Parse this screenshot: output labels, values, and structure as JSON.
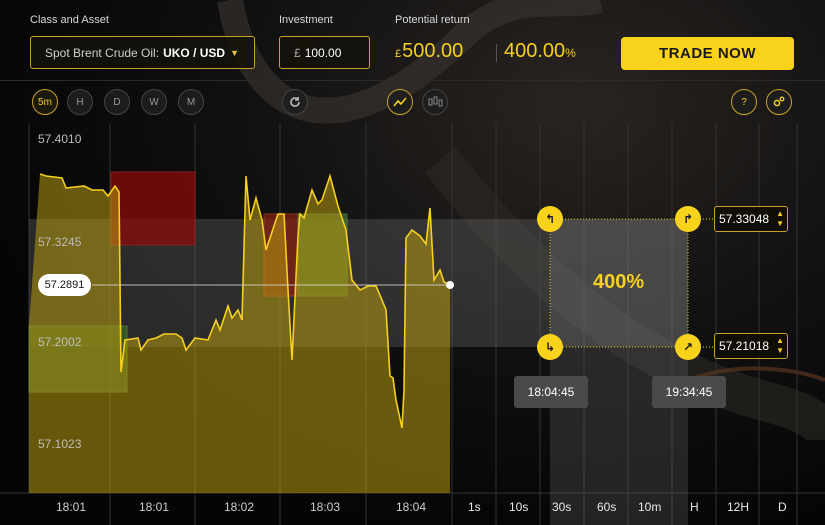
{
  "header": {
    "class_asset_label": "Class and Asset",
    "asset_prefix": "Spot Brent Crude Oil:",
    "asset_pair": "UKO / USD",
    "investment_label": "Investment",
    "investment_currency": "£",
    "investment_value": "100.00",
    "potential_return_label": "Potential return",
    "return_currency": "£",
    "return_amount": "500.00",
    "return_percent": "400.00",
    "return_percent_sign": "%",
    "trade_button": "TRADE NOW"
  },
  "toolbar": {
    "periods": [
      "5m",
      "H",
      "D",
      "W",
      "M"
    ],
    "active_period": "5m",
    "refresh_icon": "refresh-icon",
    "line_chart_icon": "line-chart-icon",
    "candle_chart_icon": "candlestick-icon",
    "help_label": "?",
    "settings_icon": "gears-icon"
  },
  "chart": {
    "y_labels": [
      "57.4010",
      "57.3245",
      "57.2002",
      "57.1023"
    ],
    "current_price": "57.2891",
    "payout_percent": "400%",
    "upper_price": "57.33048",
    "lower_price": "57.21018",
    "start_time": "18:04:45",
    "end_time": "19:34:45",
    "x_labels": [
      "18:01",
      "18:01",
      "18:02",
      "18:03",
      "18:04"
    ],
    "timeframes": [
      "1s",
      "10s",
      "30s",
      "60s",
      "10m",
      "H",
      "12H",
      "D"
    ],
    "line_color": "#f5d020"
  }
}
